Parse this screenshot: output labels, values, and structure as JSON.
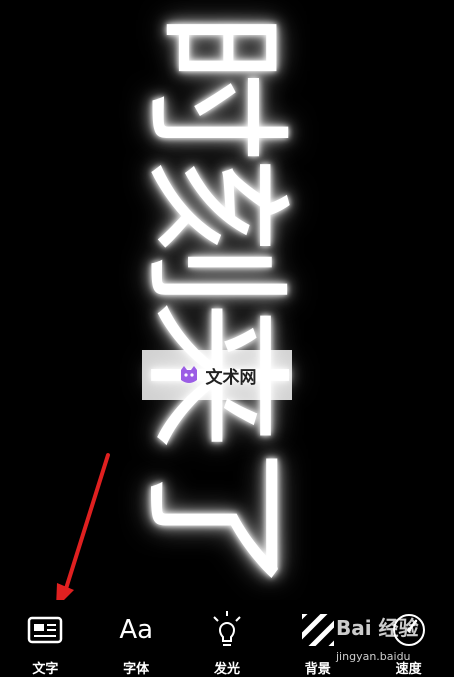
{
  "marquee": {
    "text": "时刻来了",
    "color": "#ffffff"
  },
  "watermark": {
    "text": "文术网",
    "logo_icon": "cat-logo-icon",
    "logo_color": "#9b5de5"
  },
  "annotation": {
    "icon": "red-arrow-icon",
    "color": "#e02020"
  },
  "toolbar": {
    "items": [
      {
        "icon": "text-card-icon",
        "label": "文字"
      },
      {
        "icon": "font-aa-icon",
        "glyph": "Aa",
        "label": "字体"
      },
      {
        "icon": "lightbulb-icon",
        "label": "发光"
      },
      {
        "icon": "stripes-icon",
        "label": "背景"
      },
      {
        "icon": "speedometer-icon",
        "label": "速度"
      }
    ]
  },
  "baidu_watermark": {
    "brand": "Bai 经验",
    "url": "jingyan.baidu"
  }
}
